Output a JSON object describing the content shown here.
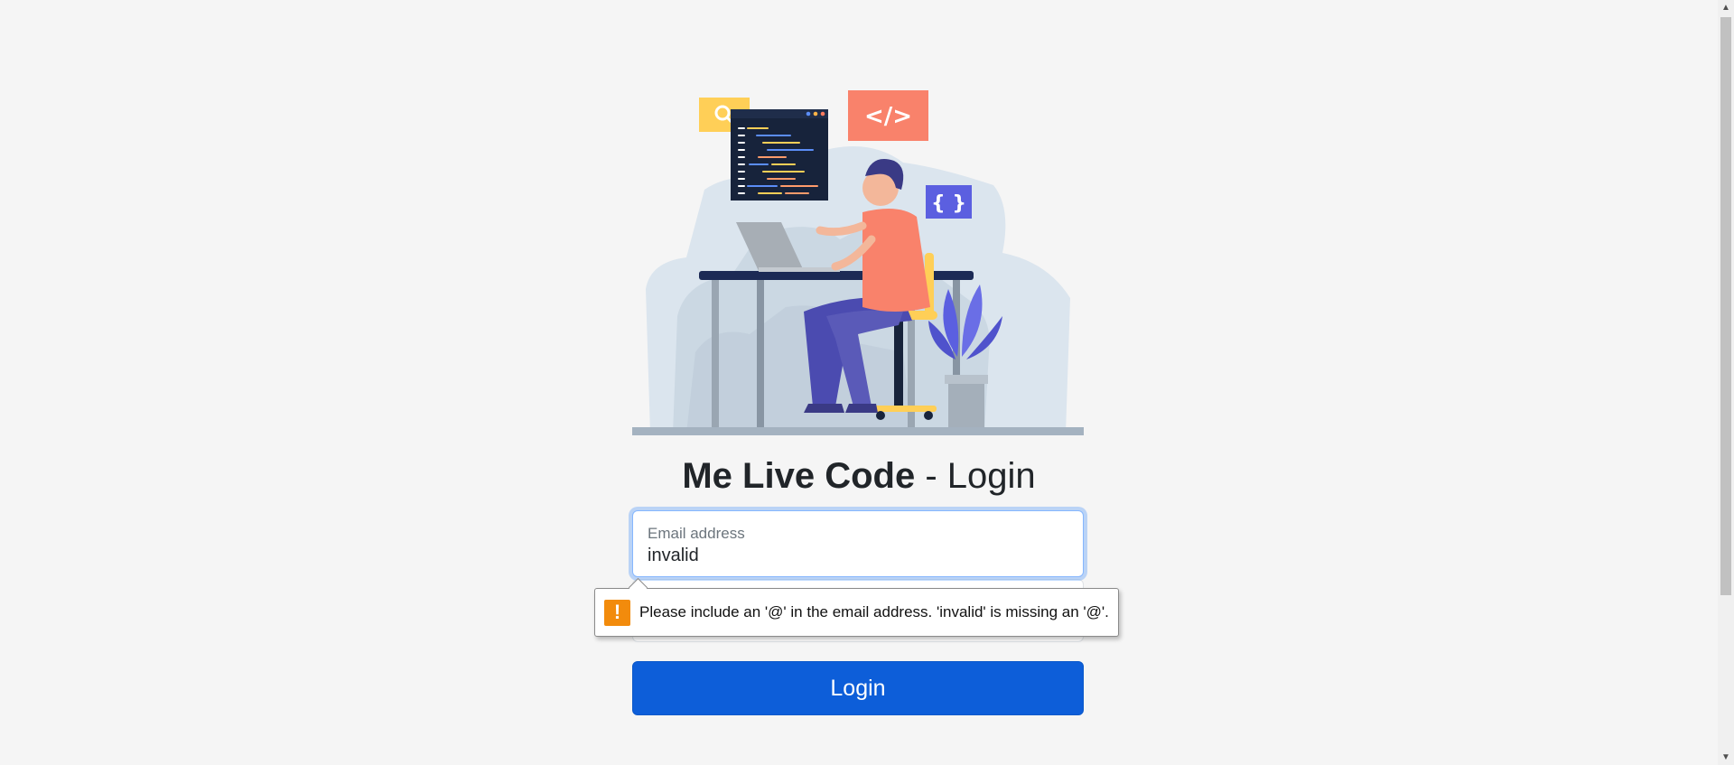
{
  "header": {
    "brand": "Me Live Code",
    "separator": " - ",
    "page": "Login"
  },
  "illustration": {
    "icons": [
      "search-icon",
      "code-icon",
      "braces-icon"
    ],
    "code_tag": "</>",
    "braces": "{ }"
  },
  "form": {
    "email": {
      "label": "Email address",
      "value": "invalid"
    },
    "submit_label": "Login"
  },
  "validation": {
    "message": "Please include an '@' in the email address. 'invalid' is missing an '@'.",
    "icon": "warning-icon",
    "icon_glyph": "!"
  },
  "colors": {
    "primary": "#0d5ed9",
    "warning": "#f28b0c",
    "coral": "#f9826b",
    "indigo": "#5b5fe0",
    "yellow": "#ffcf57"
  }
}
